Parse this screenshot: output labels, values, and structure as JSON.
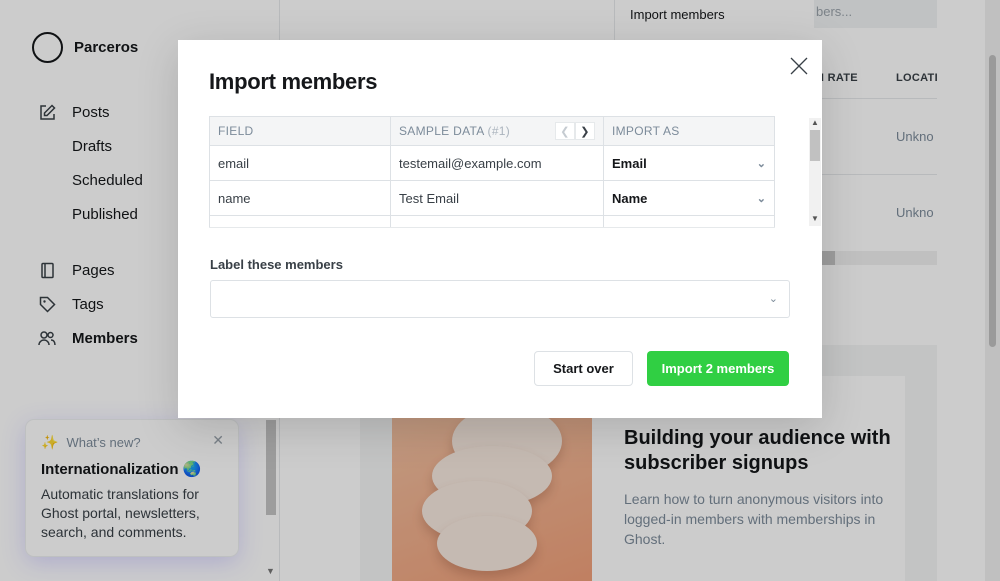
{
  "sidebar": {
    "brand_name": "Parceros",
    "nav": [
      {
        "label": "Posts",
        "icon": "edit-icon"
      },
      {
        "label": "Drafts"
      },
      {
        "label": "Scheduled"
      },
      {
        "label": "Published"
      },
      {
        "label": "Pages",
        "icon": "page-icon"
      },
      {
        "label": "Tags",
        "icon": "tag-icon"
      },
      {
        "label": "Members",
        "icon": "members-icon",
        "active": true
      }
    ],
    "whats_new": {
      "heading": "What’s new?",
      "title": "Internationalization 🌏",
      "text": "Automatic translations for Ghost portal, newsletters, search, and comments."
    }
  },
  "background": {
    "menu_item": "Import members",
    "search_placeholder": "bers...",
    "col_open_rate": "N RATE",
    "col_location": "LOCATI",
    "location_values": [
      "Unkno",
      "Unkno"
    ],
    "promo_title": "Building your audience with subscriber signups",
    "promo_text": "Learn how to turn anonymous visitors into logged-in members with memberships in Ghost."
  },
  "modal": {
    "title": "Import members",
    "table": {
      "headers": {
        "field": "FIELD",
        "sample": "SAMPLE DATA",
        "sample_index": "(#1)",
        "import_as": "IMPORT AS"
      },
      "rows": [
        {
          "field": "email",
          "sample": "testemail@example.com",
          "import_as": "Email"
        },
        {
          "field": "name",
          "sample": "Test Email",
          "import_as": "Name"
        }
      ]
    },
    "label_title": "Label these members",
    "start_over": "Start over",
    "import_button": "Import 2 members"
  },
  "colors": {
    "accent_green": "#30cf43",
    "text_dark": "#15171a",
    "muted": "#7c8b9a"
  }
}
